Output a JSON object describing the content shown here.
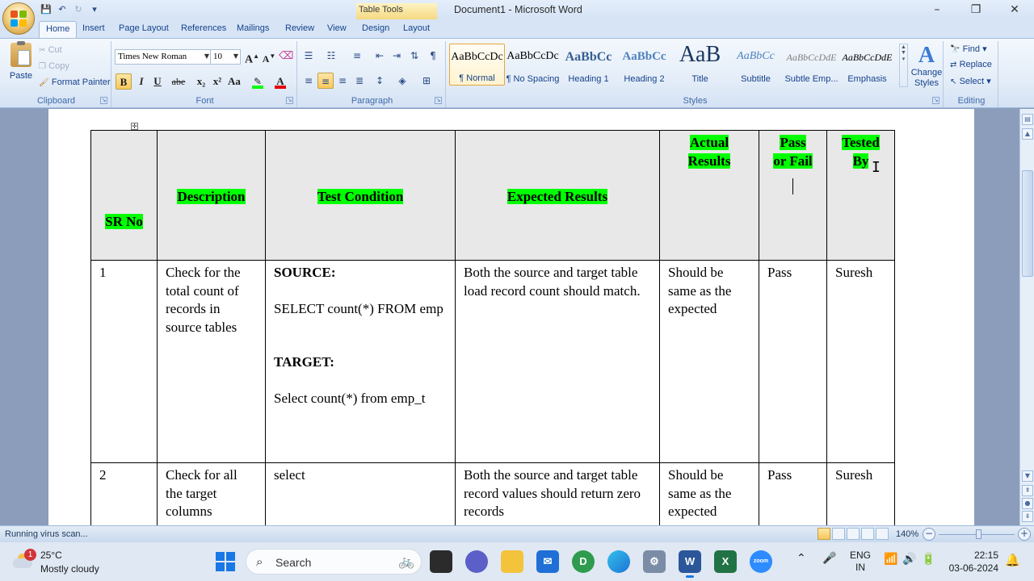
{
  "window": {
    "title": "Document1 - Microsoft Word",
    "context_tab_title": "Table Tools",
    "controls": {
      "minimize": "–",
      "restore": "❐",
      "close": "✕"
    }
  },
  "ribbon_tabs": [
    "Home",
    "Insert",
    "Page Layout",
    "References",
    "Mailings",
    "Review",
    "View",
    "Design",
    "Layout"
  ],
  "clipboard": {
    "paste": "Paste",
    "cut": "Cut",
    "copy": "Copy",
    "format_painter": "Format Painter",
    "label": "Clipboard"
  },
  "font": {
    "family": "Times New Roman",
    "size": "10",
    "bold": "B",
    "italic": "I",
    "underline": "U",
    "strike": "abe",
    "subscript": "x₂",
    "superscript": "x²",
    "change_case": "Aa",
    "grow": "A",
    "shrink": "A",
    "highlight_color": "#00ff00",
    "font_color": "#e00000",
    "label": "Font"
  },
  "paragraph": {
    "label": "Paragraph"
  },
  "styles": {
    "label": "Styles",
    "items": [
      {
        "sample": "AaBbCcDc",
        "name": "¶ Normal"
      },
      {
        "sample": "AaBbCcDc",
        "name": "¶ No Spacing"
      },
      {
        "sample": "AaBbCc",
        "name": "Heading 1"
      },
      {
        "sample": "AaBbCc",
        "name": "Heading 2"
      },
      {
        "sample": "AaB",
        "name": "Title"
      },
      {
        "sample": "AaBbCc",
        "name": "Subtitle"
      },
      {
        "sample": "AaBbCcDdE",
        "name": "Subtle Emp..."
      },
      {
        "sample": "AaBbCcDdE",
        "name": "Emphasis"
      }
    ],
    "change_styles_1": "Change",
    "change_styles_2": "Styles"
  },
  "editing": {
    "label": "Editing",
    "find": "Find",
    "replace": "Replace",
    "select": "Select"
  },
  "table": {
    "headers": [
      "SR No",
      "Description",
      "Test Condition",
      "Expected Results",
      "Actual Results",
      "Pass or Fail",
      "Tested By"
    ],
    "rows": [
      {
        "sr": "1",
        "description": "Check for the total count of records  in source tables",
        "cond_source_label": "SOURCE:",
        "cond_source_sql": "SELECT count(*) FROM emp",
        "cond_target_label": "TARGET:",
        "cond_target_sql": "Select count(*) from emp_t",
        "expected": "Both the source and target table load record count should match.",
        "actual": "Should be same as the expected",
        "pass_fail": "Pass",
        "tested_by": "Suresh"
      },
      {
        "sr": "2",
        "description": "Check for all the target columns",
        "condition": "select",
        "expected": "Both the source and target table record values should return zero records",
        "actual": "Should be same as the expected",
        "pass_fail": "Pass",
        "tested_by": "Suresh"
      }
    ]
  },
  "statusbar": {
    "text": "Running virus scan...",
    "zoom": "140%"
  },
  "taskbar": {
    "weather_badge": "1",
    "temperature": "25°C",
    "weather": "Mostly cloudy",
    "search_placeholder": "Search",
    "language_1": "ENG",
    "language_2": "IN",
    "time": "22:15",
    "date": "03-06-2024"
  }
}
